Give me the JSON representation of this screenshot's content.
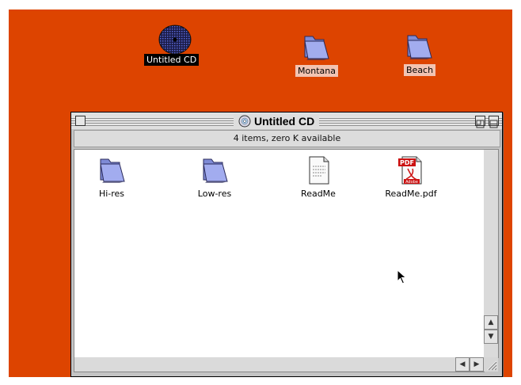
{
  "desktop": {
    "icons": [
      {
        "label": "Untitled CD",
        "icon": "cd-disc-icon",
        "selected": true
      },
      {
        "label": "Montana",
        "icon": "folder-icon",
        "selected": false
      },
      {
        "label": "Beach",
        "icon": "folder-icon",
        "selected": false
      }
    ]
  },
  "window": {
    "title": "Untitled CD",
    "title_icon": "cd-disc-icon",
    "info": "4 items, zero K available",
    "items": [
      {
        "label": "Hi-res",
        "icon": "folder-icon"
      },
      {
        "label": "Low-res",
        "icon": "folder-icon"
      },
      {
        "label": "ReadMe",
        "icon": "text-document-icon"
      },
      {
        "label": "ReadMe.pdf",
        "icon": "pdf-document-icon",
        "badge_top": "PDF",
        "badge_bottom": "Adobe"
      }
    ]
  },
  "colors": {
    "desktop": "#dd4400",
    "folder": "#9aa6e8",
    "selection": "#000000"
  }
}
